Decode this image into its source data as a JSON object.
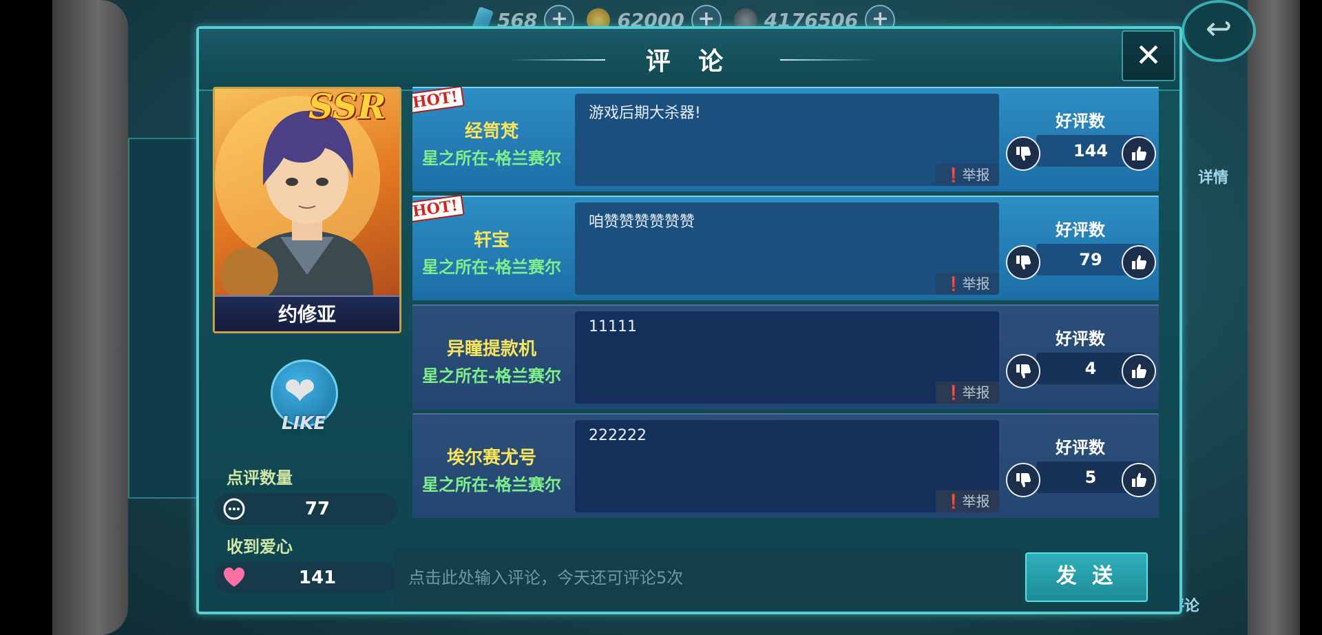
{
  "top_bar": {
    "gems": "568",
    "gold": "62000",
    "silver": "4176506",
    "back_icon": "return-arrow-icon"
  },
  "side": {
    "detail_label": "详情",
    "comment_label": "评论"
  },
  "modal": {
    "title": "评 论",
    "close_label": "✕"
  },
  "character": {
    "rarity": "SSR",
    "name": "约修亚"
  },
  "like": {
    "label": "LIKE"
  },
  "stats": {
    "review_count_label": "点评数量",
    "review_count": "77",
    "hearts_label": "收到爱心",
    "hearts": "141"
  },
  "comments": [
    {
      "hot": true,
      "hot_label": "HOT!",
      "name": "经笥梵",
      "server": "星之所在-格兰赛尔",
      "text": "游戏后期大杀器!",
      "report": "举报",
      "rating_label": "好评数",
      "rating": "144"
    },
    {
      "hot": true,
      "hot_label": "HOT!",
      "name": "轩宝",
      "server": "星之所在-格兰赛尔",
      "text": "咱赞赞赞赞赞赞",
      "report": "举报",
      "rating_label": "好评数",
      "rating": "79"
    },
    {
      "hot": false,
      "name": "异瞳提款机",
      "server": "星之所在-格兰赛尔",
      "text": "11111",
      "report": "举报",
      "rating_label": "好评数",
      "rating": "4"
    },
    {
      "hot": false,
      "name": "埃尔赛尤号",
      "server": "星之所在-格兰赛尔",
      "text": "222222",
      "report": "举报",
      "rating_label": "好评数",
      "rating": "5"
    }
  ],
  "input": {
    "placeholder": "点击此处输入评论，今天还可评论5次",
    "send_label": "发 送"
  },
  "colors": {
    "accent": "#57cfd3",
    "hot_row": "#2d8ec4",
    "normal_row": "#2c4f79",
    "name_yellow": "#f7e45a",
    "server_green": "#7ef08a"
  }
}
